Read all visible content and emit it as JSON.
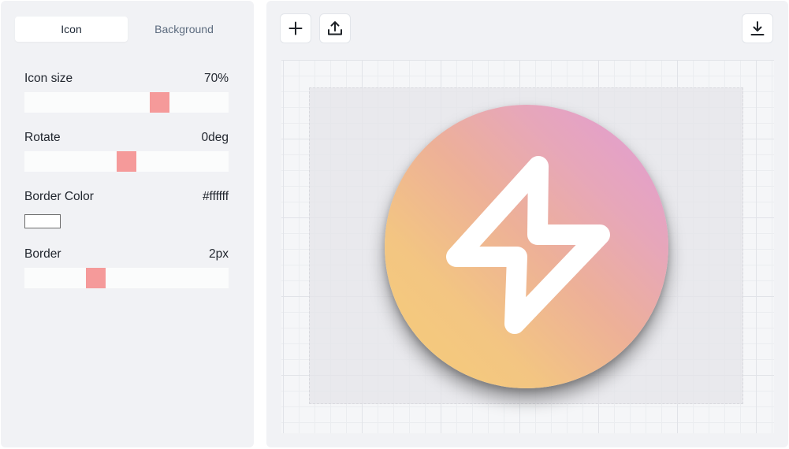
{
  "tabs": [
    {
      "label": "Icon",
      "active": true
    },
    {
      "label": "Background",
      "active": false
    }
  ],
  "controls": {
    "icon_size": {
      "label": "Icon size",
      "value": "70%",
      "level": 0.7
    },
    "rotate": {
      "label": "Rotate",
      "value": "0deg",
      "level": 0.5
    },
    "border_color": {
      "label": "Border Color",
      "value": "#ffffff"
    },
    "border": {
      "label": "Border",
      "value": "2px",
      "level": 0.35
    }
  },
  "toolbar": {
    "add_icon": "plus-icon",
    "upload_icon": "upload-icon",
    "download_icon": "download-icon"
  },
  "preview": {
    "icon": "lightning-bolt-icon",
    "icon_color": "#ffffff",
    "gradient_from": "#f5cd78",
    "gradient_to": "#e19bd8"
  },
  "colors": {
    "slider_thumb": "#f59a9a",
    "panel_bg": "#f1f2f5"
  }
}
